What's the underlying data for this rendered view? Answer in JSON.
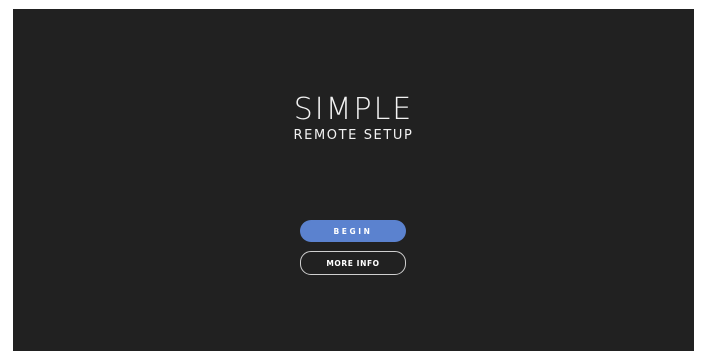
{
  "app": {
    "title": "SIMPLE",
    "subtitle": "REMOTE SETUP"
  },
  "buttons": {
    "begin_label": "BEGIN",
    "more_info_label": "MORE INFO"
  },
  "colors": {
    "background": "#212121",
    "accent": "#5b82cf",
    "text": "#f2f2f2"
  }
}
